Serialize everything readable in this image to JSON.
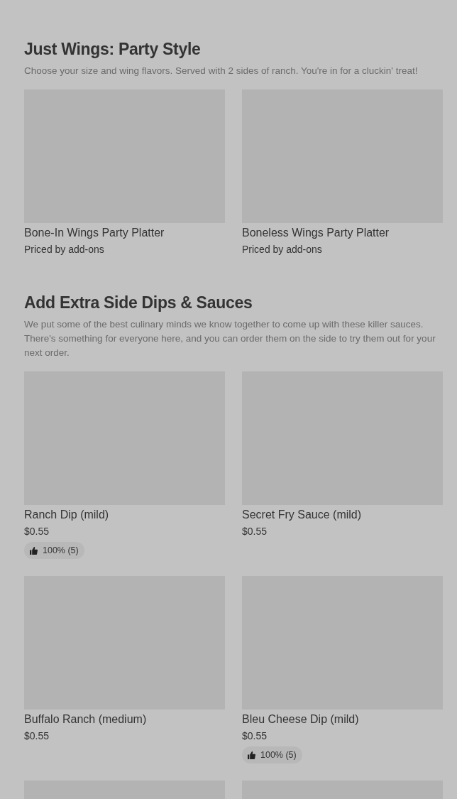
{
  "sections": [
    {
      "title": "Just Wings: Party Style",
      "description": "Choose your size and wing flavors. Served with 2 sides of ranch. You're in for a cluckin' treat!",
      "items": [
        {
          "kind": "item",
          "name": "Bone-In Wings Party Platter",
          "price": "Priced by add-ons"
        },
        {
          "kind": "item",
          "name": "Boneless Wings Party Platter",
          "price": "Priced by add-ons"
        }
      ]
    },
    {
      "title": "Add Extra Side Dips & Sauces",
      "description": "We put some of the best culinary minds we know together to come up with these killer sauces. There's something for everyone here, and you can order them on the side to try them out for your next order.",
      "items": [
        {
          "kind": "item",
          "name": "Ranch Dip (mild)",
          "price": "$0.55",
          "rating": "100% (5)"
        },
        {
          "kind": "item",
          "name": "Secret Fry Sauce (mild)",
          "price": "$0.55"
        },
        {
          "kind": "item",
          "name": "Buffalo Ranch (medium)",
          "price": "$0.55"
        },
        {
          "kind": "item",
          "name": "Bleu Cheese Dip (mild)",
          "price": "$0.55",
          "rating": "100% (5)"
        },
        {
          "kind": "image-only"
        },
        {
          "kind": "image-only"
        }
      ]
    }
  ]
}
